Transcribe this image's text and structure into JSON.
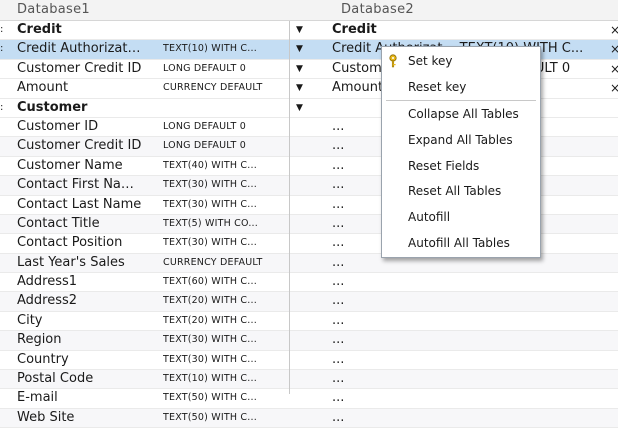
{
  "header": {
    "db1": "Database1",
    "db2": "Database2"
  },
  "rows": [
    {
      "kind": "thead",
      "name": "Credit",
      "type": "",
      "name2": "Credit",
      "x": "×",
      "arrow": "▼"
    },
    {
      "kind": "sel",
      "name": "Credit Authorizat…",
      "type": "TEXT(10) WITH C...",
      "name2": "Credit Authorizat…   TEXT(10) WITH C...",
      "x": "×",
      "arrow": "▼"
    },
    {
      "kind": "",
      "name": "Customer Credit ID",
      "type": "LONG DEFAULT 0",
      "name2": "Customer Credit ID      LONG DEFAULT 0",
      "x": "×",
      "arrow": "▼"
    },
    {
      "kind": "",
      "name": "Amount",
      "type": "CURRENCY DEFAULT",
      "name2": "Amount                 CURRENCY DEFAULT",
      "x": "×",
      "arrow": "▼"
    },
    {
      "kind": "thead",
      "name": "Customer",
      "type": "",
      "name2": "",
      "x": "",
      "arrow": "▼"
    },
    {
      "kind": "",
      "name": "Customer ID",
      "type": "LONG DEFAULT 0",
      "name2": "...",
      "x": "",
      "arrow": ""
    },
    {
      "kind": "alt",
      "name": "Customer Credit ID",
      "type": "LONG DEFAULT 0",
      "name2": "...",
      "x": "",
      "arrow": ""
    },
    {
      "kind": "",
      "name": "Customer Name",
      "type": "TEXT(40) WITH C...",
      "name2": "...",
      "x": "",
      "arrow": ""
    },
    {
      "kind": "alt",
      "name": "Contact First Na…",
      "type": "TEXT(30) WITH C...",
      "name2": "...",
      "x": "",
      "arrow": ""
    },
    {
      "kind": "",
      "name": "Contact Last Name",
      "type": "TEXT(30) WITH C...",
      "name2": "...",
      "x": "",
      "arrow": ""
    },
    {
      "kind": "alt",
      "name": "Contact Title",
      "type": "TEXT(5) WITH CO...",
      "name2": "...",
      "x": "",
      "arrow": ""
    },
    {
      "kind": "",
      "name": "Contact Position",
      "type": "TEXT(30) WITH C...",
      "name2": "...",
      "x": "",
      "arrow": ""
    },
    {
      "kind": "alt",
      "name": "Last Year's Sales",
      "type": "CURRENCY DEFAULT",
      "name2": "...",
      "x": "",
      "arrow": ""
    },
    {
      "kind": "",
      "name": "Address1",
      "type": "TEXT(60) WITH C...",
      "name2": "...",
      "x": "",
      "arrow": ""
    },
    {
      "kind": "alt",
      "name": "Address2",
      "type": "TEXT(20) WITH C...",
      "name2": "...",
      "x": "",
      "arrow": ""
    },
    {
      "kind": "",
      "name": "City",
      "type": "TEXT(20) WITH C...",
      "name2": "...",
      "x": "",
      "arrow": ""
    },
    {
      "kind": "alt",
      "name": "Region",
      "type": "TEXT(30) WITH C...",
      "name2": "...",
      "x": "",
      "arrow": ""
    },
    {
      "kind": "",
      "name": "Country",
      "type": "TEXT(30) WITH C...",
      "name2": "...",
      "x": "",
      "arrow": ""
    },
    {
      "kind": "alt",
      "name": "Postal Code",
      "type": "TEXT(10) WITH C...",
      "name2": "...",
      "x": "",
      "arrow": ""
    },
    {
      "kind": "",
      "name": "E-mail",
      "type": "TEXT(50) WITH C...",
      "name2": "...",
      "x": "",
      "arrow": ""
    },
    {
      "kind": "alt",
      "name": "Web Site",
      "type": "TEXT(50) WITH C...",
      "name2": "...",
      "x": "",
      "arrow": ""
    }
  ],
  "menu": {
    "items": [
      {
        "label": "Set key",
        "icon": "key-icon"
      },
      {
        "label": "Reset key"
      },
      {
        "label": "Collapse All Tables"
      },
      {
        "label": "Expand All Tables"
      },
      {
        "label": "Reset Fields"
      },
      {
        "label": "Reset All Tables"
      },
      {
        "label": "Autofill"
      },
      {
        "label": "Autofill All Tables"
      }
    ]
  }
}
